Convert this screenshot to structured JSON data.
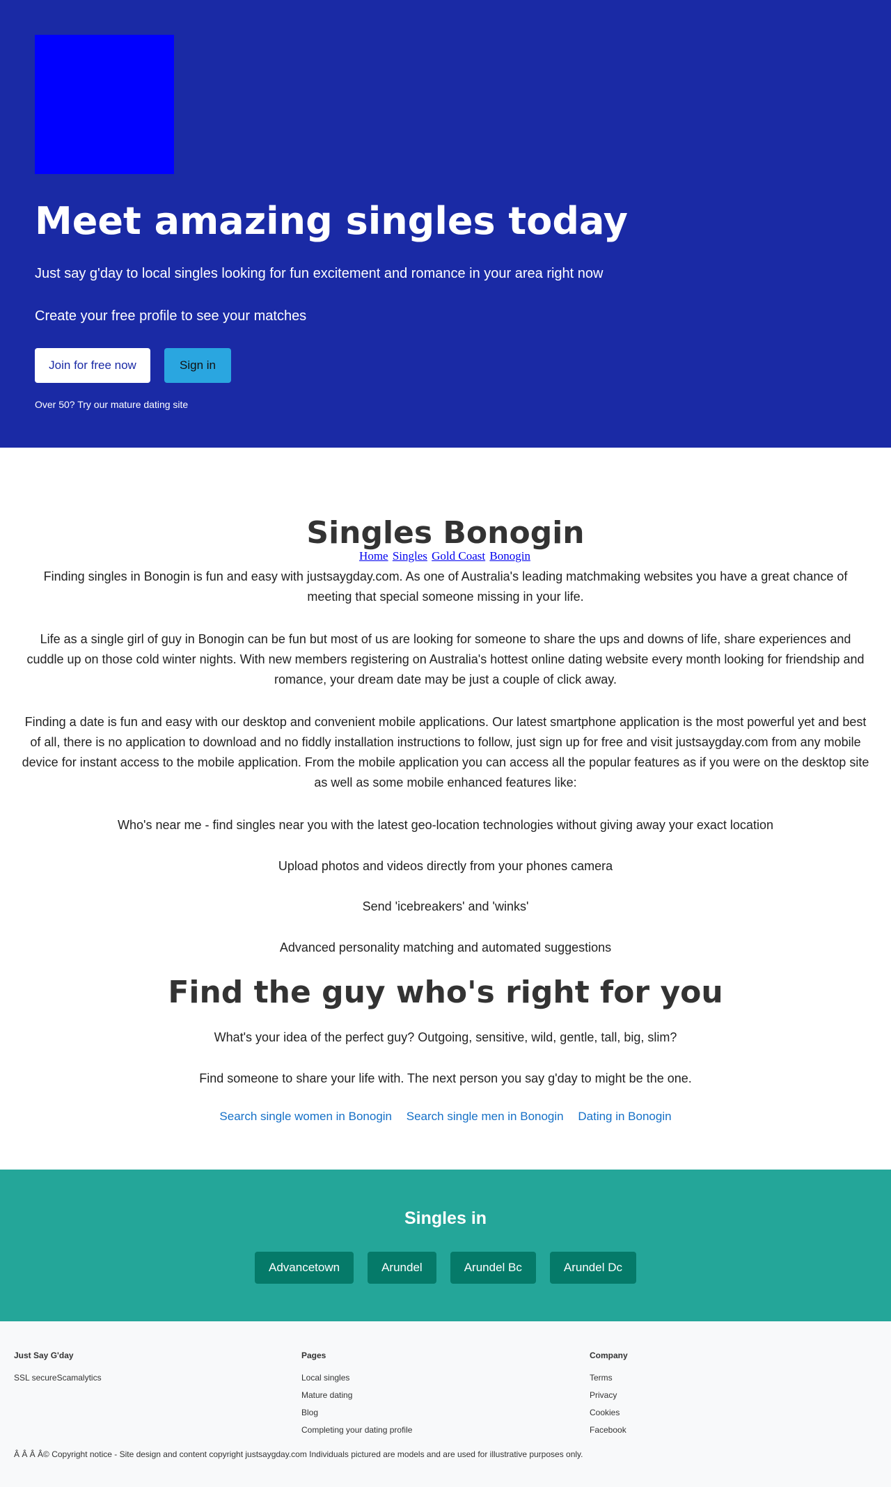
{
  "hero": {
    "logo_alt": "",
    "title": "Meet amazing singles today",
    "subtitle": "Just say g'day to local singles looking for fun excitement and romance in your area right now",
    "cta_text": "Create your free profile to see your matches",
    "join_label": "Join for free now",
    "signin_label": "Sign in",
    "mature_link": "Over 50? Try our mature dating site",
    "colors": {
      "background": "#1a2aa5",
      "logo": "#0000ff",
      "signin": "#2aa6e0"
    }
  },
  "breadcrumb": [
    "Home",
    "Singles",
    "Gold Coast",
    "Bonogin"
  ],
  "main": {
    "title": "Singles Bonogin",
    "paragraphs": [
      "Finding singles in Bonogin is fun and easy with justsaygday.com. As one of Australia's leading matchmaking websites you have a great chance of meeting that special someone missing in your life.",
      "Life as a single girl of guy in Bonogin can be fun but most of us are looking for someone to share the ups and downs of life, share experiences and cuddle up on those cold winter nights. With new members registering on Australia's hottest online dating website every month looking for friendship and romance, your dream date may be just a couple of click away.",
      "Finding a date is fun and easy with our desktop and convenient mobile applications. Our latest smartphone application is the most powerful yet and best of all, there is no application to download and no fiddly installation instructions to follow, just sign up for free and visit justsaygday.com from any mobile device for instant access to the mobile application. From the mobile application you can access all the popular features as if you were on the desktop site as well as some mobile enhanced features like:",
      "Who's near me - find singles near you with the latest geo-location technologies without giving away your exact location",
      "Upload photos and videos directly from your phones camera",
      "Send 'icebreakers' and 'winks'",
      "Advanced personality matching and automated suggestions"
    ],
    "find_title": "Find the guy who's right for you",
    "find_paragraphs": [
      "What's your idea of the perfect guy? Outgoing, sensitive, wild, gentle, tall, big, slim?",
      "Find someone to share your life with. The next person you say g'day to might be the one."
    ],
    "search_links": [
      "Search single women in Bonogin",
      "Search single men in Bonogin",
      "Dating in Bonogin"
    ]
  },
  "singles_in": {
    "title": "Singles in",
    "suburbs": [
      "Advancetown",
      "Arundel",
      "Arundel Bc",
      "Arundel Dc"
    ],
    "colors": {
      "background": "#24a699",
      "button": "#057a69"
    }
  },
  "footer": {
    "col1": {
      "heading": "Just Say G'day",
      "items": [
        "SSL secureScamalytics"
      ]
    },
    "col2": {
      "heading": "Pages",
      "items": [
        "Local singles",
        "Mature dating",
        "Blog",
        "Completing your dating profile"
      ]
    },
    "col3": {
      "heading": "Company",
      "items": [
        "Terms",
        "Privacy",
        "Cookies",
        "Facebook"
      ]
    },
    "copyright": "Â   Â   Â   Â© Copyright notice - Site design and content copyright justsaygday.com Individuals pictured are models and are used for illustrative purposes only."
  }
}
